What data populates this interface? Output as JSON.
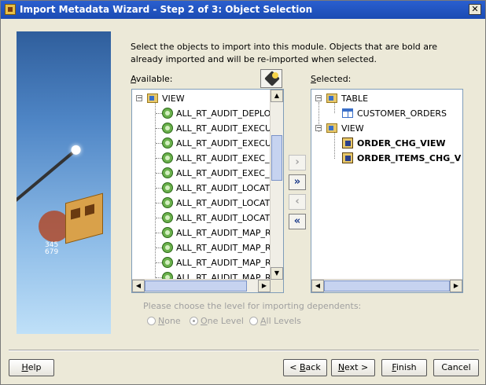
{
  "window": {
    "title": "Import Metadata Wizard - Step 2 of 3: Object Selection",
    "close_glyph": "✕"
  },
  "instruction": "Select the objects to import into this module. Objects that are bold are already imported and will be re-imported when selected.",
  "available": {
    "label_mnemonic": "A",
    "label_rest": "vailable:",
    "root": "VIEW",
    "items": [
      "ALL_RT_AUDIT_DEPLOYI",
      "ALL_RT_AUDIT_EXECUTI",
      "ALL_RT_AUDIT_EXECUTI",
      "ALL_RT_AUDIT_EXEC_FIL",
      "ALL_RT_AUDIT_EXEC_ME",
      "ALL_RT_AUDIT_LOCATIO",
      "ALL_RT_AUDIT_LOCATIO",
      "ALL_RT_AUDIT_LOCATIO",
      "ALL_RT_AUDIT_MAP_RU",
      "ALL_RT_AUDIT_MAP_RU",
      "ALL_RT_AUDIT_MAP_RU",
      "ALL_RT_AUDIT_MAP_RU"
    ]
  },
  "selected": {
    "label_mnemonic": "S",
    "label_rest": "elected:",
    "table_folder": "TABLE",
    "table_items": [
      "CUSTOMER_ORDERS"
    ],
    "view_folder": "VIEW",
    "view_items": [
      "ORDER_CHG_VIEW",
      "ORDER_ITEMS_CHG_VIEW"
    ]
  },
  "move_buttons": {
    "add": "›",
    "add_all": "»",
    "remove": "‹",
    "remove_all": "«"
  },
  "dependents": {
    "label": "Please choose the level for importing dependents:",
    "options": [
      {
        "mnemonic": "N",
        "rest": "one"
      },
      {
        "mnemonic": "O",
        "rest": "ne Level"
      },
      {
        "mnemonic": "A",
        "rest": "ll Levels"
      }
    ],
    "selected_index": 1
  },
  "buttons": {
    "help": {
      "mnemonic": "H",
      "rest": "elp"
    },
    "back": {
      "prefix": "< ",
      "mnemonic": "B",
      "rest": "ack"
    },
    "next": {
      "mnemonic": "N",
      "rest": "ext >"
    },
    "finish": {
      "mnemonic": "F",
      "rest": "inish"
    },
    "cancel": "Cancel"
  },
  "banner": {
    "digits": "345\n679"
  }
}
